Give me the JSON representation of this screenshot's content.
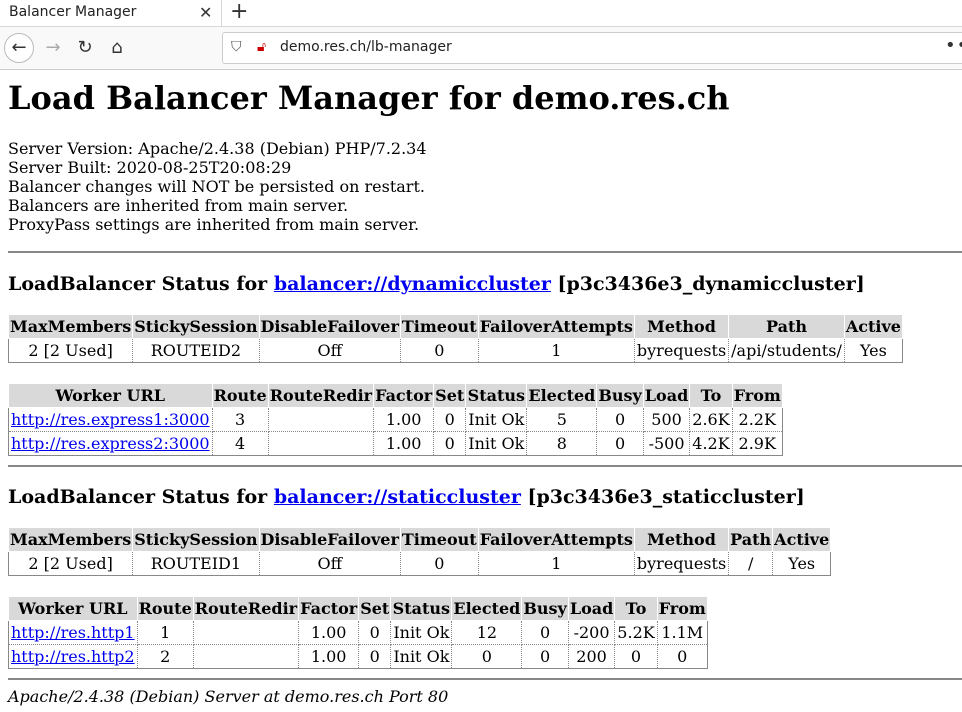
{
  "browser": {
    "tab_title": "Balancer Manager",
    "url": "demo.res.ch/lb-manager"
  },
  "page": {
    "title": "Load Balancer Manager for demo.res.ch",
    "server_version": "Server Version: Apache/2.4.38 (Debian) PHP/7.2.34",
    "server_built": "Server Built: 2020-08-25T20:08:29",
    "notes": [
      "Balancer changes will NOT be persisted on restart.",
      "Balancers are inherited from main server.",
      "ProxyPass settings are inherited from main server."
    ],
    "status_prefix": "LoadBalancer Status for",
    "footer": "Apache/2.4.38 (Debian) Server at demo.res.ch Port 80"
  },
  "balancer_headers": [
    "MaxMembers",
    "StickySession",
    "DisableFailover",
    "Timeout",
    "FailoverAttempts",
    "Method",
    "Path",
    "Active"
  ],
  "worker_headers": [
    "Worker URL",
    "Route",
    "RouteRedir",
    "Factor",
    "Set",
    "Status",
    "Elected",
    "Busy",
    "Load",
    "To",
    "From"
  ],
  "balancers": [
    {
      "link": "balancer://dynamiccluster",
      "suffix": "[p3c3436e3_dynamiccluster]",
      "settings": [
        "2 [2 Used]",
        "ROUTEID2",
        "Off",
        "0",
        "1",
        "byrequests",
        "/api/students/",
        "Yes"
      ],
      "workers": [
        [
          "http://res.express1:3000",
          "3",
          "",
          "1.00",
          "0",
          "Init Ok",
          "5",
          "0",
          "500",
          "2.6K",
          "2.2K"
        ],
        [
          "http://res.express2:3000",
          "4",
          "",
          "1.00",
          "0",
          "Init Ok",
          "8",
          "0",
          "-500",
          "4.2K",
          "2.9K"
        ]
      ]
    },
    {
      "link": "balancer://staticcluster",
      "suffix": "[p3c3436e3_staticcluster]",
      "settings": [
        "2 [2 Used]",
        "ROUTEID1",
        "Off",
        "0",
        "1",
        "byrequests",
        "/",
        "Yes"
      ],
      "workers": [
        [
          "http://res.http1",
          "1",
          "",
          "1.00",
          "0",
          "Init Ok",
          "12",
          "0",
          "-200",
          "5.2K",
          "1.1M"
        ],
        [
          "http://res.http2",
          "2",
          "",
          "1.00",
          "0",
          "Init Ok",
          "0",
          "0",
          "200",
          "0",
          "0"
        ]
      ]
    }
  ]
}
